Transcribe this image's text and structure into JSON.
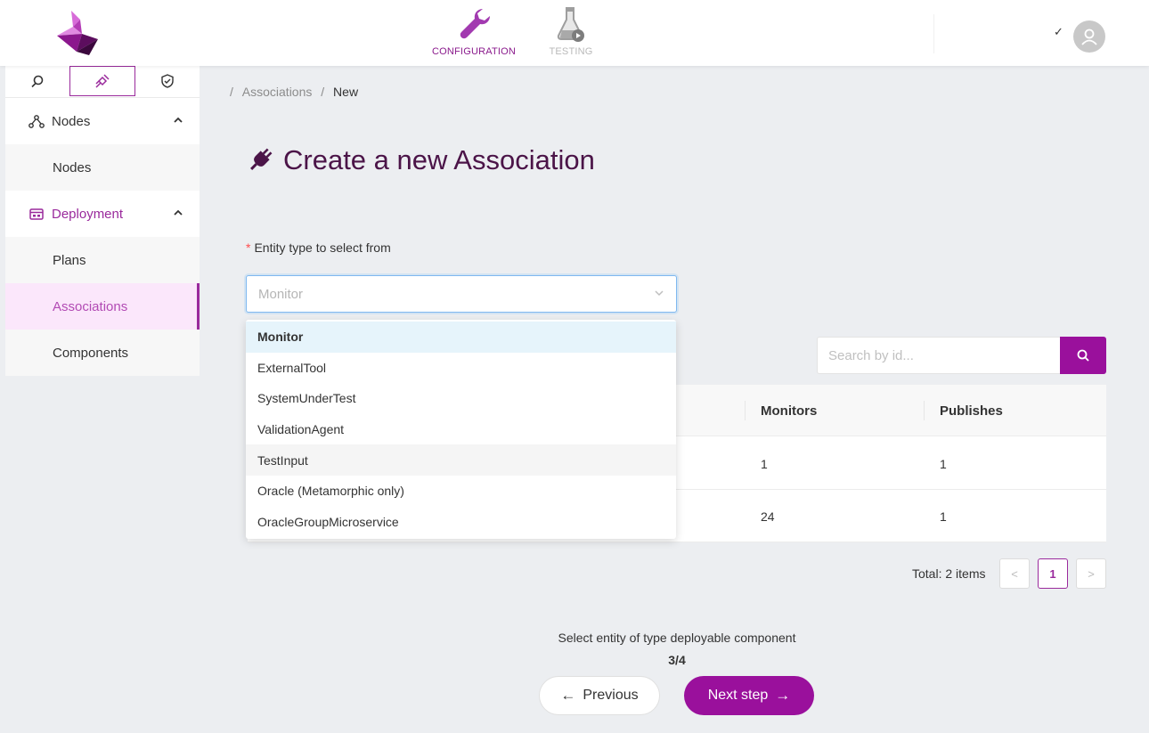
{
  "header": {
    "nav": [
      {
        "label": "CONFIGURATION",
        "icon": "wrench-icon",
        "active": true,
        "color": "#8a1a8c"
      },
      {
        "label": "TESTING",
        "icon": "flask-icon",
        "active": false,
        "color": "#b9b9b9"
      }
    ],
    "user_chevron": "✓",
    "avatar_icon": "user-icon"
  },
  "sidebar": {
    "tabs": [
      "search-icon",
      "plug-icon",
      "shield-check-icon"
    ],
    "groups": [
      {
        "label": "Nodes",
        "icon": "nodes-icon",
        "items": [
          "Nodes"
        ]
      },
      {
        "label": "Deployment",
        "icon": "deployment-icon",
        "items": [
          "Plans",
          "Associations",
          "Components"
        ],
        "active_item": "Associations"
      }
    ]
  },
  "breadcrumb": {
    "sep": "/",
    "parent": "Associations",
    "current": "New"
  },
  "page": {
    "title": "Create a new Association",
    "title_icon": "plug-icon"
  },
  "form": {
    "required_mark": "*",
    "label": "Entity type to select from",
    "select_value": "Monitor",
    "options": [
      "Monitor",
      "ExternalTool",
      "SystemUnderTest",
      "ValidationAgent",
      "TestInput",
      "Oracle (Metamorphic only)",
      "OracleGroupMicroservice"
    ],
    "selected_option": "Monitor",
    "hovered_option": "TestInput"
  },
  "search": {
    "placeholder": "Search by id..."
  },
  "table": {
    "columns": [
      "Monitors",
      "Publishes"
    ],
    "rows": [
      [
        "1",
        "1"
      ],
      [
        "24",
        "1"
      ]
    ]
  },
  "pagination": {
    "total": "Total: 2 items",
    "prev": "<",
    "page": "1",
    "next": ">"
  },
  "stepper": {
    "text": "Select entity of type deployable component",
    "count": "3/4"
  },
  "buttons": {
    "previous": "Previous",
    "next": "Next step",
    "previous_arrow": "←",
    "next_arrow": "→"
  },
  "colors": {
    "accent": "#9a109c",
    "title": "#4b1448",
    "active_bg": "#fbe7fb"
  }
}
